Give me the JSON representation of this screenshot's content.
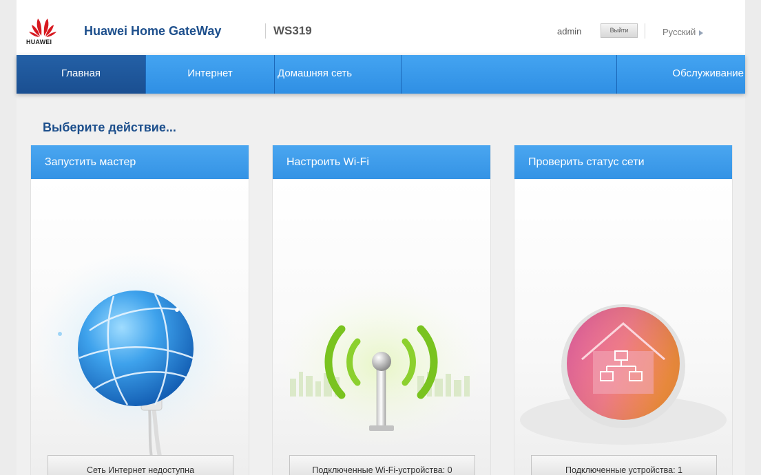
{
  "header": {
    "logo_text": "HUAWEI",
    "brand": "Huawei Home GateWay",
    "model": "WS319",
    "user": "admin",
    "logout_label": "Выйти",
    "language": "Русский"
  },
  "nav": {
    "items": [
      {
        "label": "Главная",
        "active": true
      },
      {
        "label": "Интернет",
        "active": false
      },
      {
        "label": "Домашняя сеть",
        "active": false
      },
      {
        "label": "Обслуживание",
        "active": false
      }
    ]
  },
  "main": {
    "title": "Выберите действие...",
    "cards": [
      {
        "title": "Запустить мастер",
        "status": "Сеть Интернет недоступна",
        "icon": "globe-icon"
      },
      {
        "title": "Настроить Wi-Fi",
        "status": "Подключенные Wi-Fi-устройства: 0",
        "icon": "wifi-antenna-icon"
      },
      {
        "title": "Проверить статус сети",
        "status": "Подключенные устройства: 1",
        "icon": "home-network-icon"
      }
    ]
  },
  "colors": {
    "accent_blue": "#3a9aea",
    "nav_active": "#1f57a0",
    "brand_text": "#1d4f8c",
    "wifi_green": "#7ac52b",
    "house_pink": "#ea6f98",
    "house_orange": "#ef8b3a"
  }
}
